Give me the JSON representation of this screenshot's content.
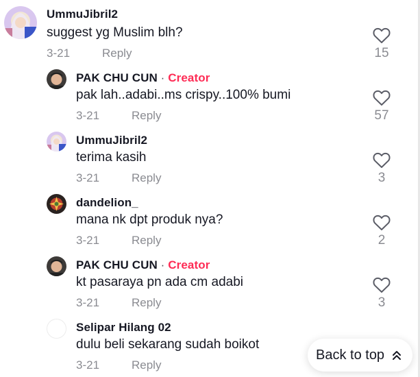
{
  "comments": [
    {
      "username": "UmmuJibril2",
      "creator_sep": "",
      "creator": "",
      "text": "suggest yg Muslim blh?",
      "date": "3-21",
      "reply": "Reply",
      "likes": "15",
      "avatar": "hijab"
    },
    {
      "username": "PAK CHU CUN",
      "creator_sep": " · ",
      "creator": "Creator",
      "text": "pak lah..adabi..ms crispy..100% bumi",
      "date": "3-21",
      "reply": "Reply",
      "likes": "57",
      "avatar": "man"
    },
    {
      "username": "UmmuJibril2",
      "creator_sep": "",
      "creator": "",
      "text": "terima kasih",
      "date": "3-21",
      "reply": "Reply",
      "likes": "3",
      "avatar": "hijab"
    },
    {
      "username": "dandelion_",
      "creator_sep": "",
      "creator": "",
      "text": "mana nk dpt produk nya?",
      "date": "3-21",
      "reply": "Reply",
      "likes": "2",
      "avatar": "flower"
    },
    {
      "username": "PAK CHU CUN",
      "creator_sep": " · ",
      "creator": "Creator",
      "text": "kt pasaraya pn ada cm adabi",
      "date": "3-21",
      "reply": "Reply",
      "likes": "3",
      "avatar": "man"
    },
    {
      "username": "Selipar Hilang 02",
      "creator_sep": "",
      "creator": "",
      "text": "dulu beli sekarang sudah boikot",
      "date": "3-21",
      "reply": "Reply",
      "likes": "",
      "avatar": "blank"
    }
  ],
  "back_to_top": {
    "label": "Back to top",
    "icon": "double-chevron-up-icon"
  },
  "colors": {
    "creator": "#fe2c55",
    "muted": "#8a8b91",
    "text": "#161823"
  }
}
